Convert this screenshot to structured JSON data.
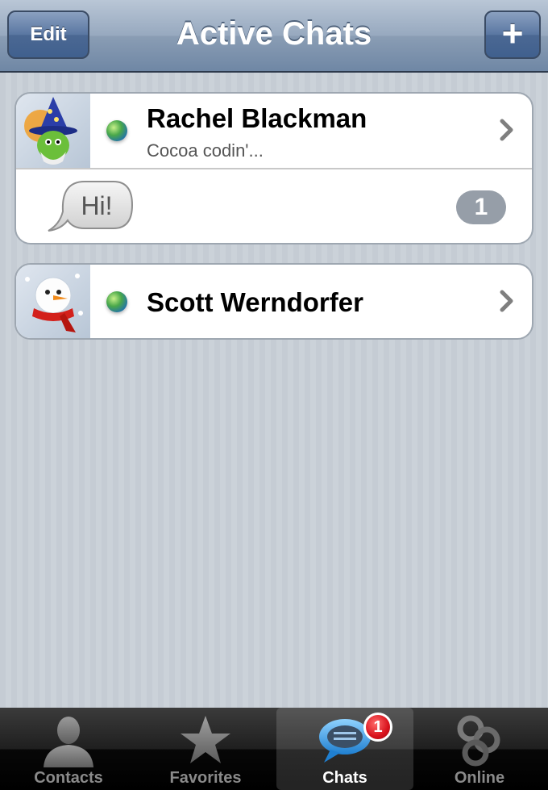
{
  "navbar": {
    "title": "Active Chats",
    "edit_label": "Edit",
    "add_label": "+"
  },
  "chats": [
    {
      "name": "Rachel Blackman",
      "status": "Cocoa codin'...",
      "avatar": "wizard-avatar",
      "presence": "online-globe-icon",
      "last_message": "Hi!",
      "unread": "1"
    },
    {
      "name": "Scott Werndorfer",
      "avatar": "snowman-avatar",
      "presence": "online-globe-icon"
    }
  ],
  "tabbar": {
    "tabs": [
      {
        "label": "Contacts",
        "icon": "person-icon"
      },
      {
        "label": "Favorites",
        "icon": "star-icon"
      },
      {
        "label": "Chats",
        "icon": "chat-bubble-icon",
        "badge": "1",
        "selected": true
      },
      {
        "label": "Online",
        "icon": "online-rings-icon"
      }
    ]
  },
  "colors": {
    "navbar_tint": "#6f87a5",
    "badge_red": "#d8121c",
    "background_stripe": "#c5ccd4"
  }
}
